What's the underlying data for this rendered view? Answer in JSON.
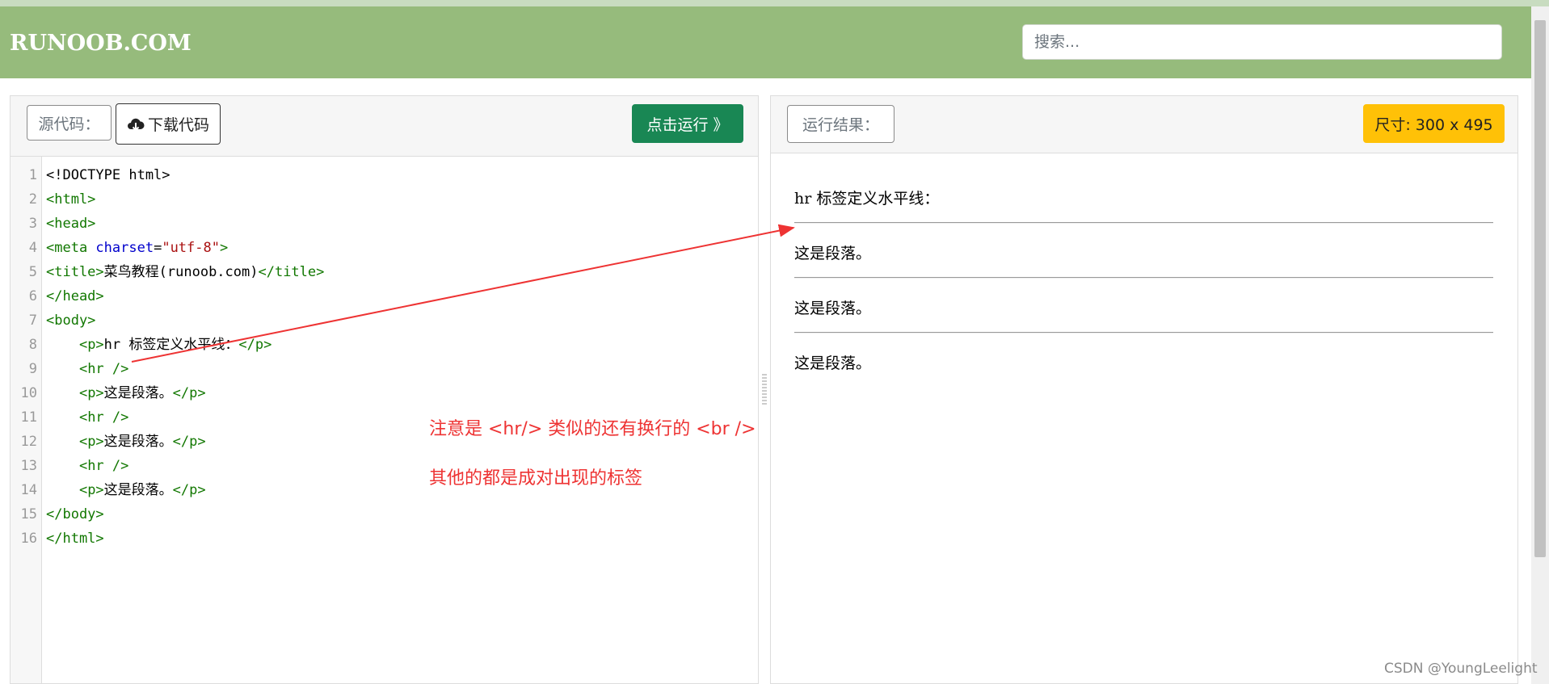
{
  "header": {
    "logo": "RUNOOB.COM",
    "search_placeholder": "搜索..."
  },
  "editor": {
    "source_label": "源代码：",
    "download_label": "下载代码",
    "run_label": "点击运行 》",
    "lines": [
      {
        "n": "1",
        "segs": [
          {
            "t": "<!DOCTYPE html>",
            "c": "txt"
          }
        ]
      },
      {
        "n": "2",
        "segs": [
          {
            "t": "<html>",
            "c": "tag"
          }
        ]
      },
      {
        "n": "3",
        "segs": [
          {
            "t": "<head>",
            "c": "tag"
          }
        ]
      },
      {
        "n": "4",
        "segs": [
          {
            "t": "<meta ",
            "c": "tag"
          },
          {
            "t": "charset",
            "c": "attr"
          },
          {
            "t": "=",
            "c": "txt"
          },
          {
            "t": "\"utf-8\"",
            "c": "str"
          },
          {
            "t": ">",
            "c": "tag"
          }
        ]
      },
      {
        "n": "5",
        "segs": [
          {
            "t": "<title>",
            "c": "tag"
          },
          {
            "t": "菜鸟教程(runoob.com)",
            "c": "txt"
          },
          {
            "t": "</title>",
            "c": "tag"
          }
        ]
      },
      {
        "n": "6",
        "segs": [
          {
            "t": "</head>",
            "c": "tag"
          }
        ]
      },
      {
        "n": "7",
        "segs": [
          {
            "t": "<body>",
            "c": "tag"
          }
        ]
      },
      {
        "n": "8",
        "segs": [
          {
            "t": "    ",
            "c": "txt"
          },
          {
            "t": "<p>",
            "c": "tag"
          },
          {
            "t": "hr 标签定义水平线：",
            "c": "txt"
          },
          {
            "t": "</p>",
            "c": "tag"
          }
        ]
      },
      {
        "n": "9",
        "segs": [
          {
            "t": "    ",
            "c": "txt"
          },
          {
            "t": "<hr />",
            "c": "tag"
          }
        ]
      },
      {
        "n": "10",
        "segs": [
          {
            "t": "    ",
            "c": "txt"
          },
          {
            "t": "<p>",
            "c": "tag"
          },
          {
            "t": "这是段落。",
            "c": "txt"
          },
          {
            "t": "</p>",
            "c": "tag"
          }
        ]
      },
      {
        "n": "11",
        "segs": [
          {
            "t": "    ",
            "c": "txt"
          },
          {
            "t": "<hr />",
            "c": "tag"
          }
        ]
      },
      {
        "n": "12",
        "segs": [
          {
            "t": "    ",
            "c": "txt"
          },
          {
            "t": "<p>",
            "c": "tag"
          },
          {
            "t": "这是段落。",
            "c": "txt"
          },
          {
            "t": "</p>",
            "c": "tag"
          }
        ]
      },
      {
        "n": "13",
        "segs": [
          {
            "t": "    ",
            "c": "txt"
          },
          {
            "t": "<hr />",
            "c": "tag"
          }
        ]
      },
      {
        "n": "14",
        "segs": [
          {
            "t": "    ",
            "c": "txt"
          },
          {
            "t": "<p>",
            "c": "tag"
          },
          {
            "t": "这是段落。",
            "c": "txt"
          },
          {
            "t": "</p>",
            "c": "tag"
          }
        ]
      },
      {
        "n": "15",
        "segs": [
          {
            "t": "</body>",
            "c": "tag"
          }
        ]
      },
      {
        "n": "16",
        "segs": [
          {
            "t": "</html>",
            "c": "tag"
          }
        ]
      }
    ]
  },
  "annotation": {
    "line1": "注意是 <hr/>  类似的还有换行的 <br />",
    "line2": "其他的都是成对出现的标签",
    "color": "#ee3333"
  },
  "result": {
    "label": "运行结果：",
    "size_label": "尺寸: 300 x 495",
    "heading": "hr 标签定义水平线：",
    "paragraphs": [
      "这是段落。",
      "这是段落。",
      "这是段落。"
    ]
  },
  "watermark": "CSDN @YoungLeelight"
}
